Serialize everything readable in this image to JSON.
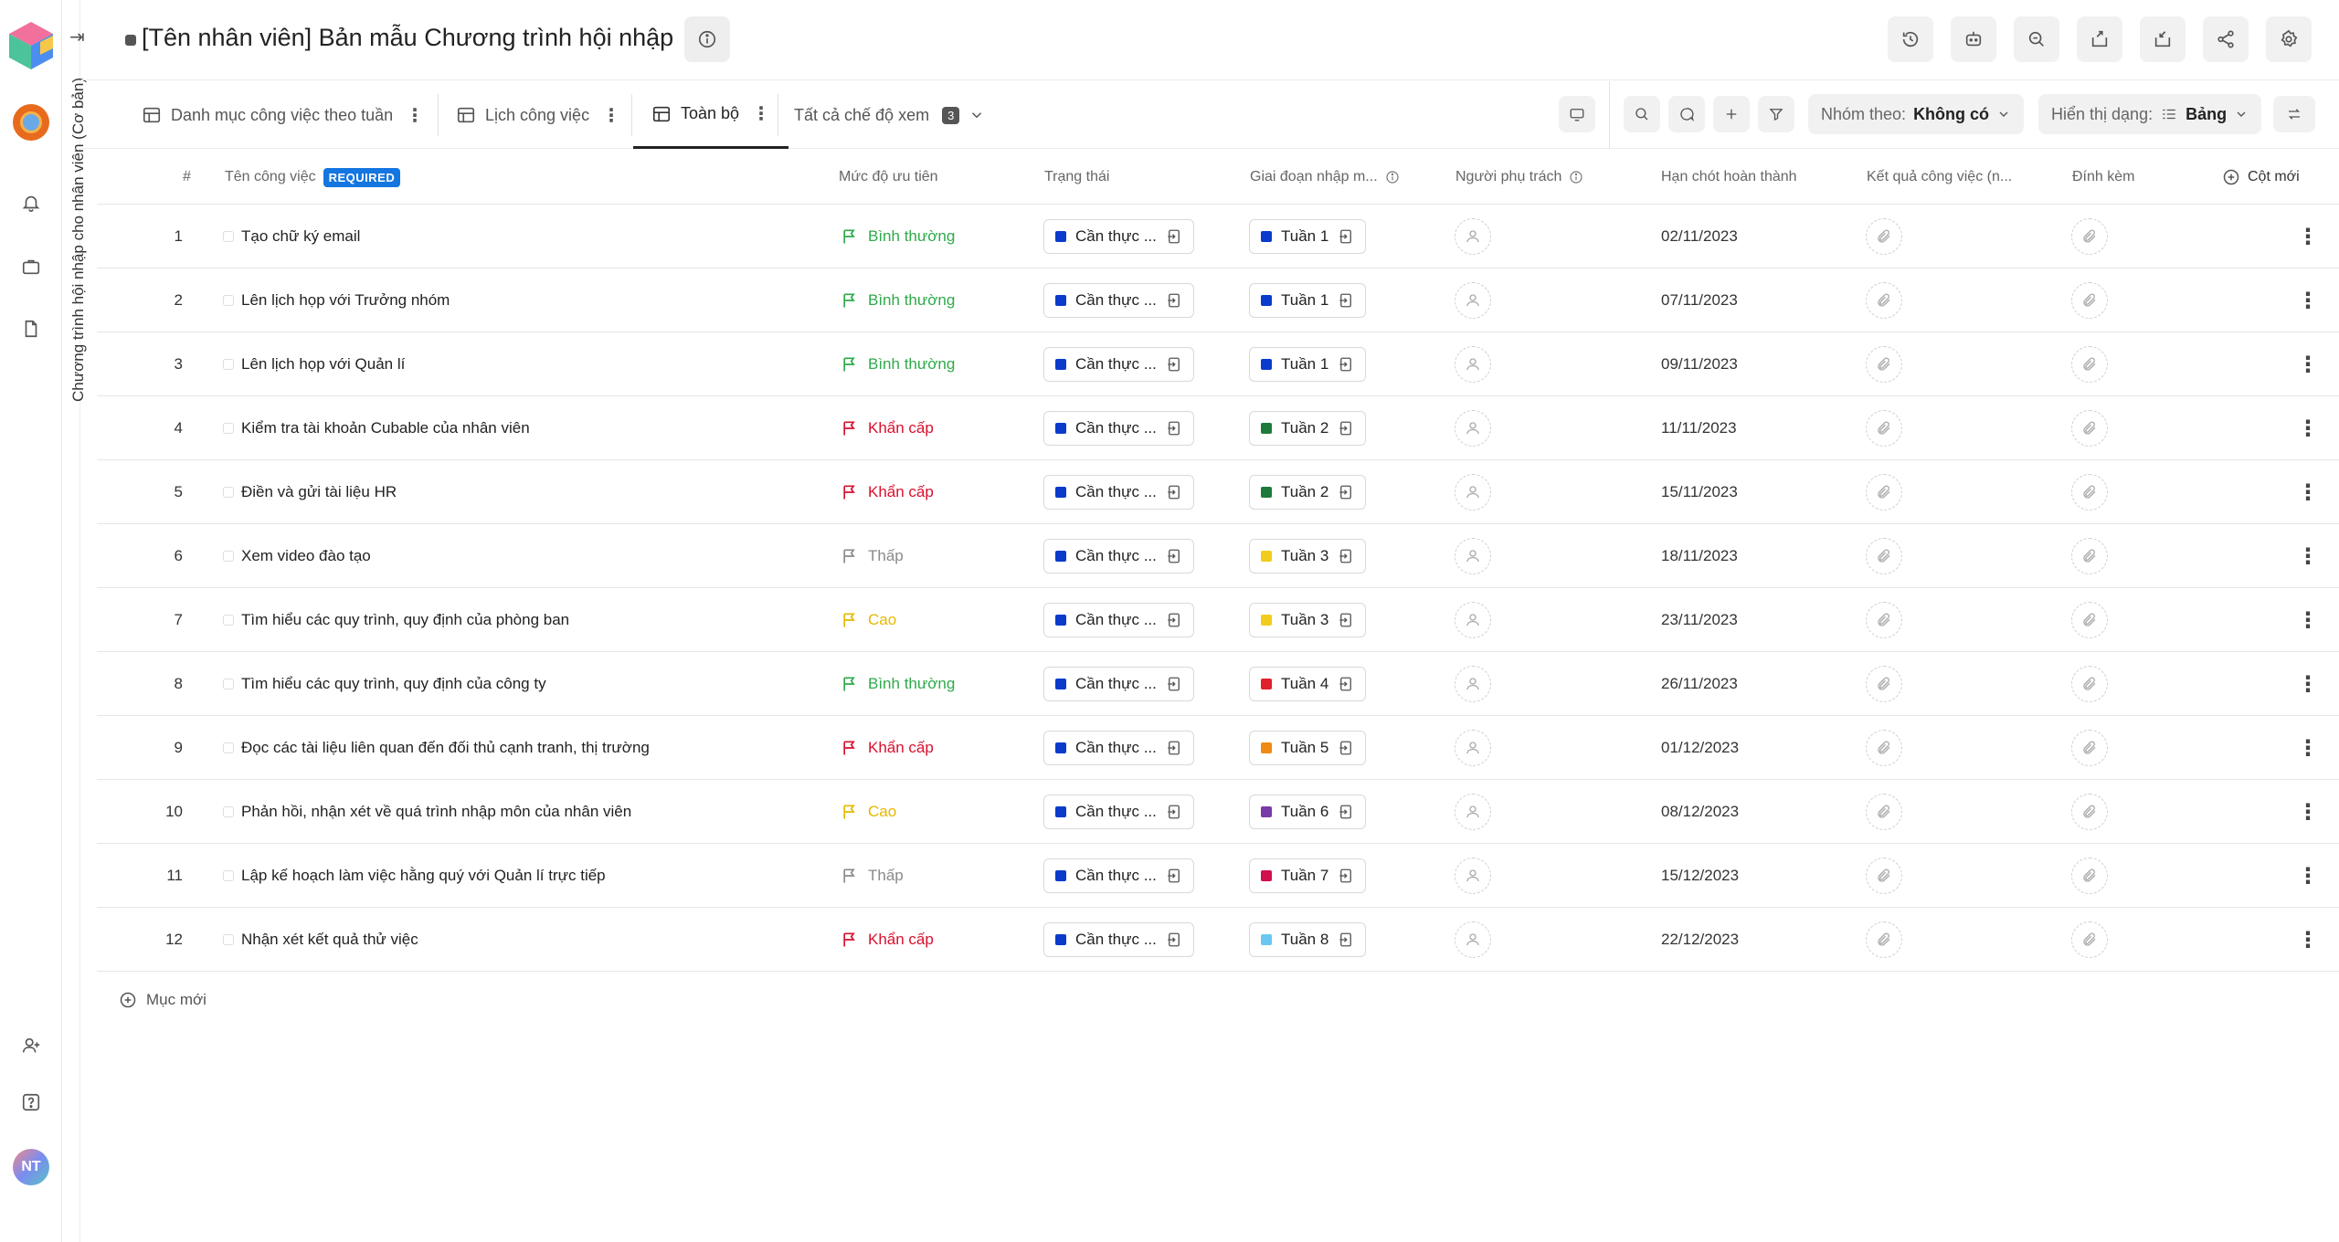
{
  "doc_panel": {
    "vertical_title": "Chương trình hội nhập cho nhân viên (Cơ bản)"
  },
  "user": {
    "initials": "NT"
  },
  "header": {
    "title": "[Tên nhân viên] Bản mẫu Chương trình hội nhập"
  },
  "tabs": [
    {
      "label": "Danh mục công việc theo tuần"
    },
    {
      "label": "Lịch công việc"
    },
    {
      "label": "Toàn bộ"
    }
  ],
  "view_selector": {
    "label": "Tất cả chế độ xem",
    "count": "3"
  },
  "toolbar": {
    "group_label": "Nhóm theo:",
    "group_value": "Không có",
    "display_label": "Hiển thị dạng:",
    "display_value": "Bảng"
  },
  "columns": {
    "num": "#",
    "task": "Tên công việc",
    "task_required": "REQUIRED",
    "priority": "Mức độ ưu tiên",
    "status": "Trạng thái",
    "phase": "Giai đoạn nhập m...",
    "assignee": "Người phụ trách",
    "deadline": "Hạn chót hoàn thành",
    "result": "Kết quả công việc (n...",
    "attach": "Đính kèm",
    "new_column": "Cột mới"
  },
  "priority_colors": {
    "Bình thường": "#2eaa4a",
    "Khẩn cấp": "#d8102e",
    "Thấp": "#8a8a8a",
    "Cao": "#e6b800"
  },
  "rows": [
    {
      "num": "1",
      "task": "Tạo chữ ký email",
      "priority": "Bình thường",
      "status": "Cần thực ...",
      "phase": "Tuần 1",
      "phase_color": "#0a3bcc",
      "deadline": "02/11/2023"
    },
    {
      "num": "2",
      "task": "Lên lịch họp với Trưởng nhóm",
      "priority": "Bình thường",
      "status": "Cần thực ...",
      "phase": "Tuần 1",
      "phase_color": "#0a3bcc",
      "deadline": "07/11/2023"
    },
    {
      "num": "3",
      "task": "Lên lịch họp với Quản lí",
      "priority": "Bình thường",
      "status": "Cần thực ...",
      "phase": "Tuần 1",
      "phase_color": "#0a3bcc",
      "deadline": "09/11/2023"
    },
    {
      "num": "4",
      "task": "Kiểm tra tài khoản Cubable của nhân viên",
      "priority": "Khẩn cấp",
      "status": "Cần thực ...",
      "phase": "Tuần 2",
      "phase_color": "#1e7a3a",
      "deadline": "11/11/2023"
    },
    {
      "num": "5",
      "task": "Điền và gửi tài liệu HR",
      "priority": "Khẩn cấp",
      "status": "Cần thực ...",
      "phase": "Tuần 2",
      "phase_color": "#1e7a3a",
      "deadline": "15/11/2023"
    },
    {
      "num": "6",
      "task": "Xem video đào tạo",
      "priority": "Thấp",
      "status": "Cần thực ...",
      "phase": "Tuần 3",
      "phase_color": "#f2cc1a",
      "deadline": "18/11/2023"
    },
    {
      "num": "7",
      "task": "Tìm hiểu các quy trình, quy định của phòng ban",
      "priority": "Cao",
      "status": "Cần thực ...",
      "phase": "Tuần 3",
      "phase_color": "#f2cc1a",
      "deadline": "23/11/2023"
    },
    {
      "num": "8",
      "task": "Tìm hiểu các quy trình, quy định của công ty",
      "priority": "Bình thường",
      "status": "Cần thực ...",
      "phase": "Tuần 4",
      "phase_color": "#e0202a",
      "deadline": "26/11/2023"
    },
    {
      "num": "9",
      "task": "Đọc các tài liệu liên quan đến đối thủ cạnh tranh, thị trường",
      "priority": "Khẩn cấp",
      "status": "Cần thực ...",
      "phase": "Tuần 5",
      "phase_color": "#f08a14",
      "deadline": "01/12/2023"
    },
    {
      "num": "10",
      "task": "Phản hồi, nhận xét về quá trình nhập môn của nhân viên",
      "priority": "Cao",
      "status": "Cần thực ...",
      "phase": "Tuần 6",
      "phase_color": "#7a3aa8",
      "deadline": "08/12/2023"
    },
    {
      "num": "11",
      "task": "Lập kế hoạch làm việc hằng quý với Quản lí trực tiếp",
      "priority": "Thấp",
      "status": "Cần thực ...",
      "phase": "Tuần 7",
      "phase_color": "#d0104a",
      "deadline": "15/12/2023"
    },
    {
      "num": "12",
      "task": "Nhận xét kết quả thử việc",
      "priority": "Khẩn cấp",
      "status": "Cần thực ...",
      "phase": "Tuần 8",
      "phase_color": "#6ac8f0",
      "deadline": "22/12/2023"
    }
  ],
  "status_color": "#0a3bcc",
  "add_item": "Mục mới"
}
